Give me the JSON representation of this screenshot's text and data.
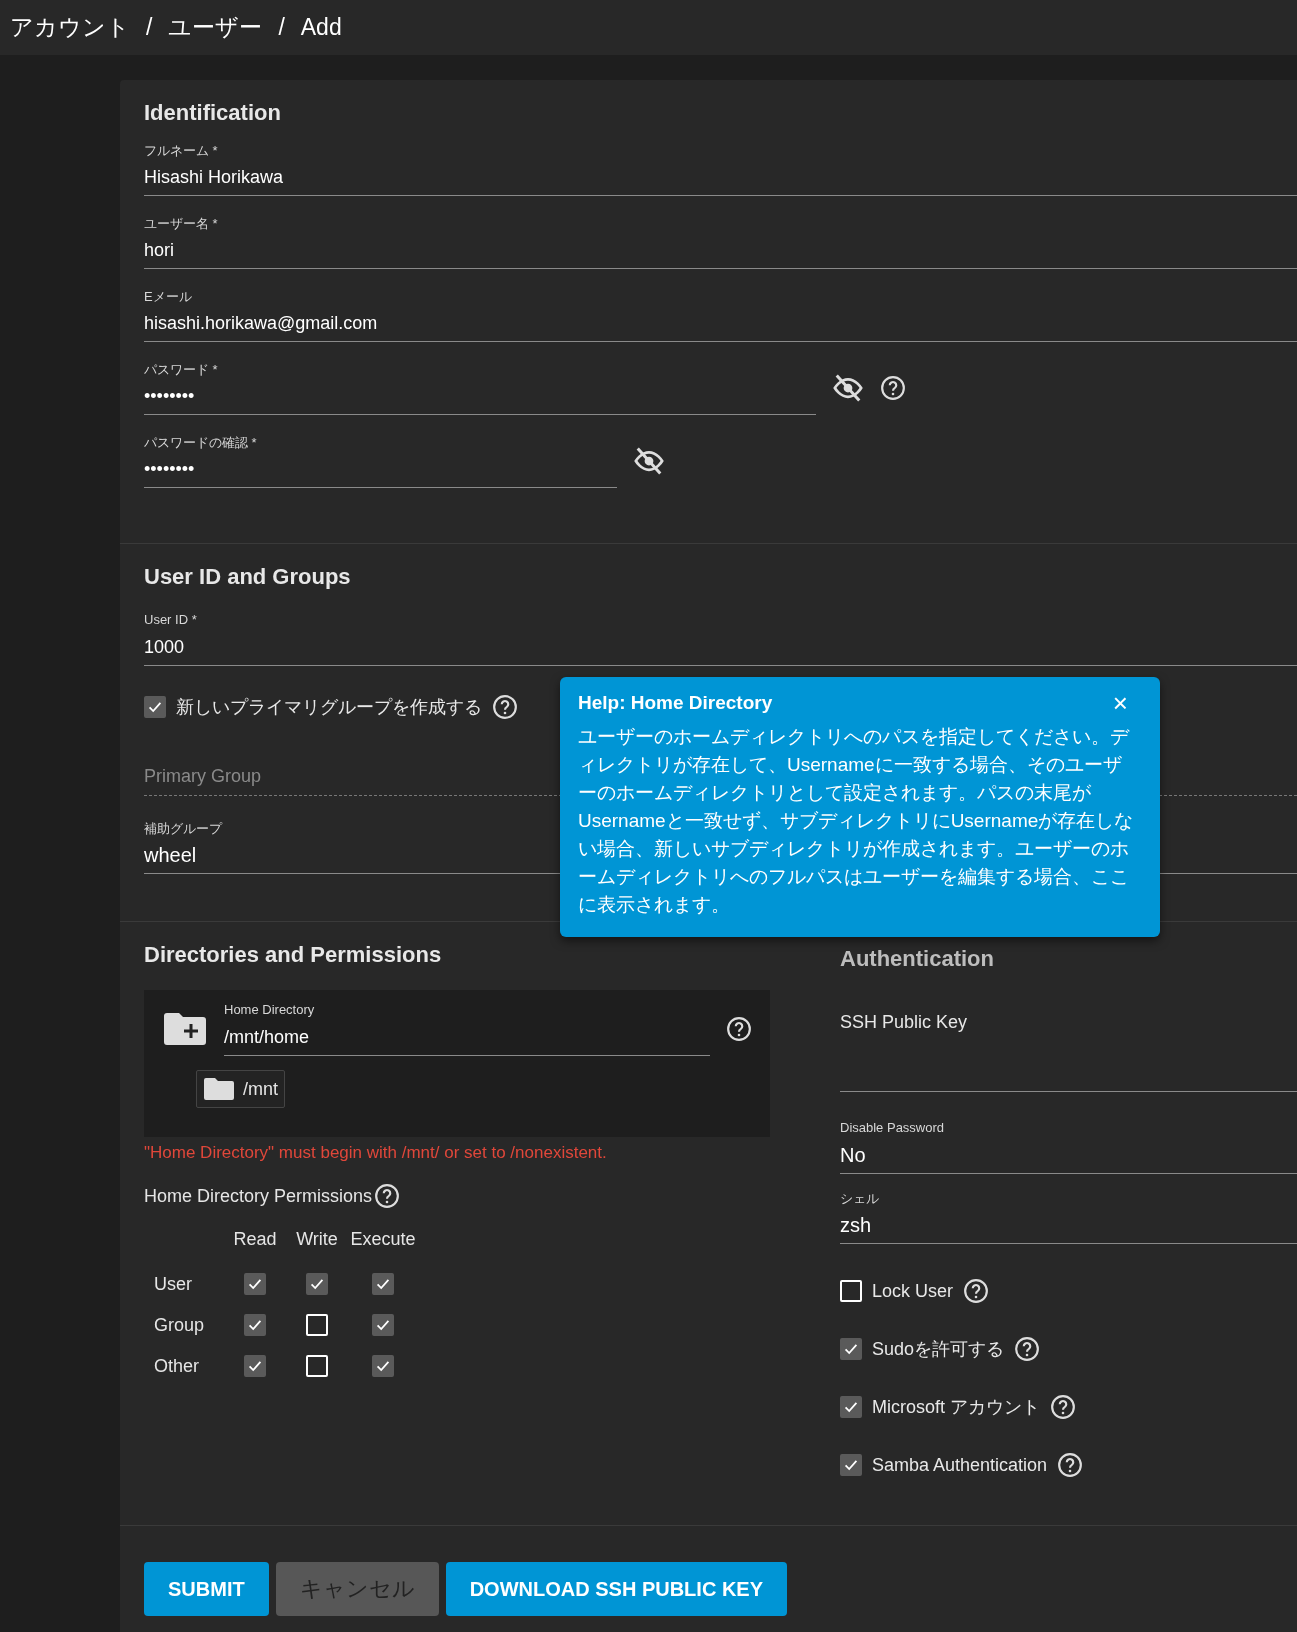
{
  "breadcrumb": {
    "separator": "/",
    "items": [
      "アカウント",
      "ユーザー",
      "Add"
    ]
  },
  "identification": {
    "title": "Identification",
    "fields": [
      {
        "kind": "text",
        "label": "フルネーム *",
        "value": "Hisashi Horikawa",
        "help": false
      },
      {
        "kind": "text",
        "label": "ユーザー名 *",
        "value": "hori",
        "help": false
      },
      {
        "kind": "text",
        "label": "Eメール",
        "value": "hisashi.horikawa@gmail.com",
        "help": false
      },
      {
        "kind": "password",
        "label": "パスワード *",
        "value": "••••••••",
        "help": true
      },
      {
        "kind": "password",
        "label": "パスワードの確認 *",
        "value": "••••••••",
        "help": false
      }
    ]
  },
  "user_groups": {
    "title": "User ID and Groups",
    "user_id": {
      "label": "User ID *",
      "value": "1000"
    },
    "new_group": {
      "label": "新しいプライマリグループを作成する",
      "checked": true,
      "help": true
    },
    "primary_group": {
      "placeholder": "Primary Group"
    },
    "auxiliary": {
      "label": "補助グループ",
      "value": "wheel"
    }
  },
  "directories": {
    "title": "Directories and Permissions",
    "home_directory": {
      "label": "Home Directory",
      "value": "/mnt/home"
    },
    "tree_item": "/mnt",
    "error": "\"Home Directory\" must begin with /mnt/ or set to /nonexistent.",
    "permissions": {
      "title": "Home Directory Permissions",
      "columns": [
        "Read",
        "Write",
        "Execute"
      ],
      "rows": [
        {
          "label": "User",
          "checks": [
            true,
            true,
            true
          ]
        },
        {
          "label": "Group",
          "checks": [
            true,
            false,
            true
          ]
        },
        {
          "label": "Other",
          "checks": [
            true,
            false,
            true
          ]
        }
      ]
    }
  },
  "authentication": {
    "title": "Authentication",
    "ssh_key": {
      "label": "SSH Public Key"
    },
    "disable_password": {
      "label": "Disable Password",
      "value": "No"
    },
    "shell": {
      "label": "シェル",
      "value": "zsh"
    },
    "options": [
      {
        "label": "Lock User",
        "checked": false,
        "help": true
      },
      {
        "label": "Sudoを許可する",
        "checked": true,
        "help": true
      },
      {
        "label": "Microsoft アカウント",
        "checked": true,
        "help": true
      },
      {
        "label": "Samba Authentication",
        "checked": true,
        "help": true
      }
    ]
  },
  "tooltip": {
    "title": "Help: Home Directory",
    "close": "×",
    "body": "ユーザーのホームディレクトリへのパスを指定してください。ディレクトリが存在して、Usernameに一致する場合、そのユーザーのホームディレクトリとして設定されます。パスの末尾がUsernameと一致せず、サブディレクトリにUsernameが存在しない場合、新しいサブディレクトリが作成されます。ユーザーのホームディレクトリへのフルパスはユーザーを編集する場合、ここに表示されます。"
  },
  "buttons": [
    {
      "label": "SUBMIT",
      "kind": "primary"
    },
    {
      "label": "キャンセル",
      "kind": "secondary"
    },
    {
      "label": "DOWNLOAD SSH PUBLIC KEY",
      "kind": "primary"
    }
  ]
}
